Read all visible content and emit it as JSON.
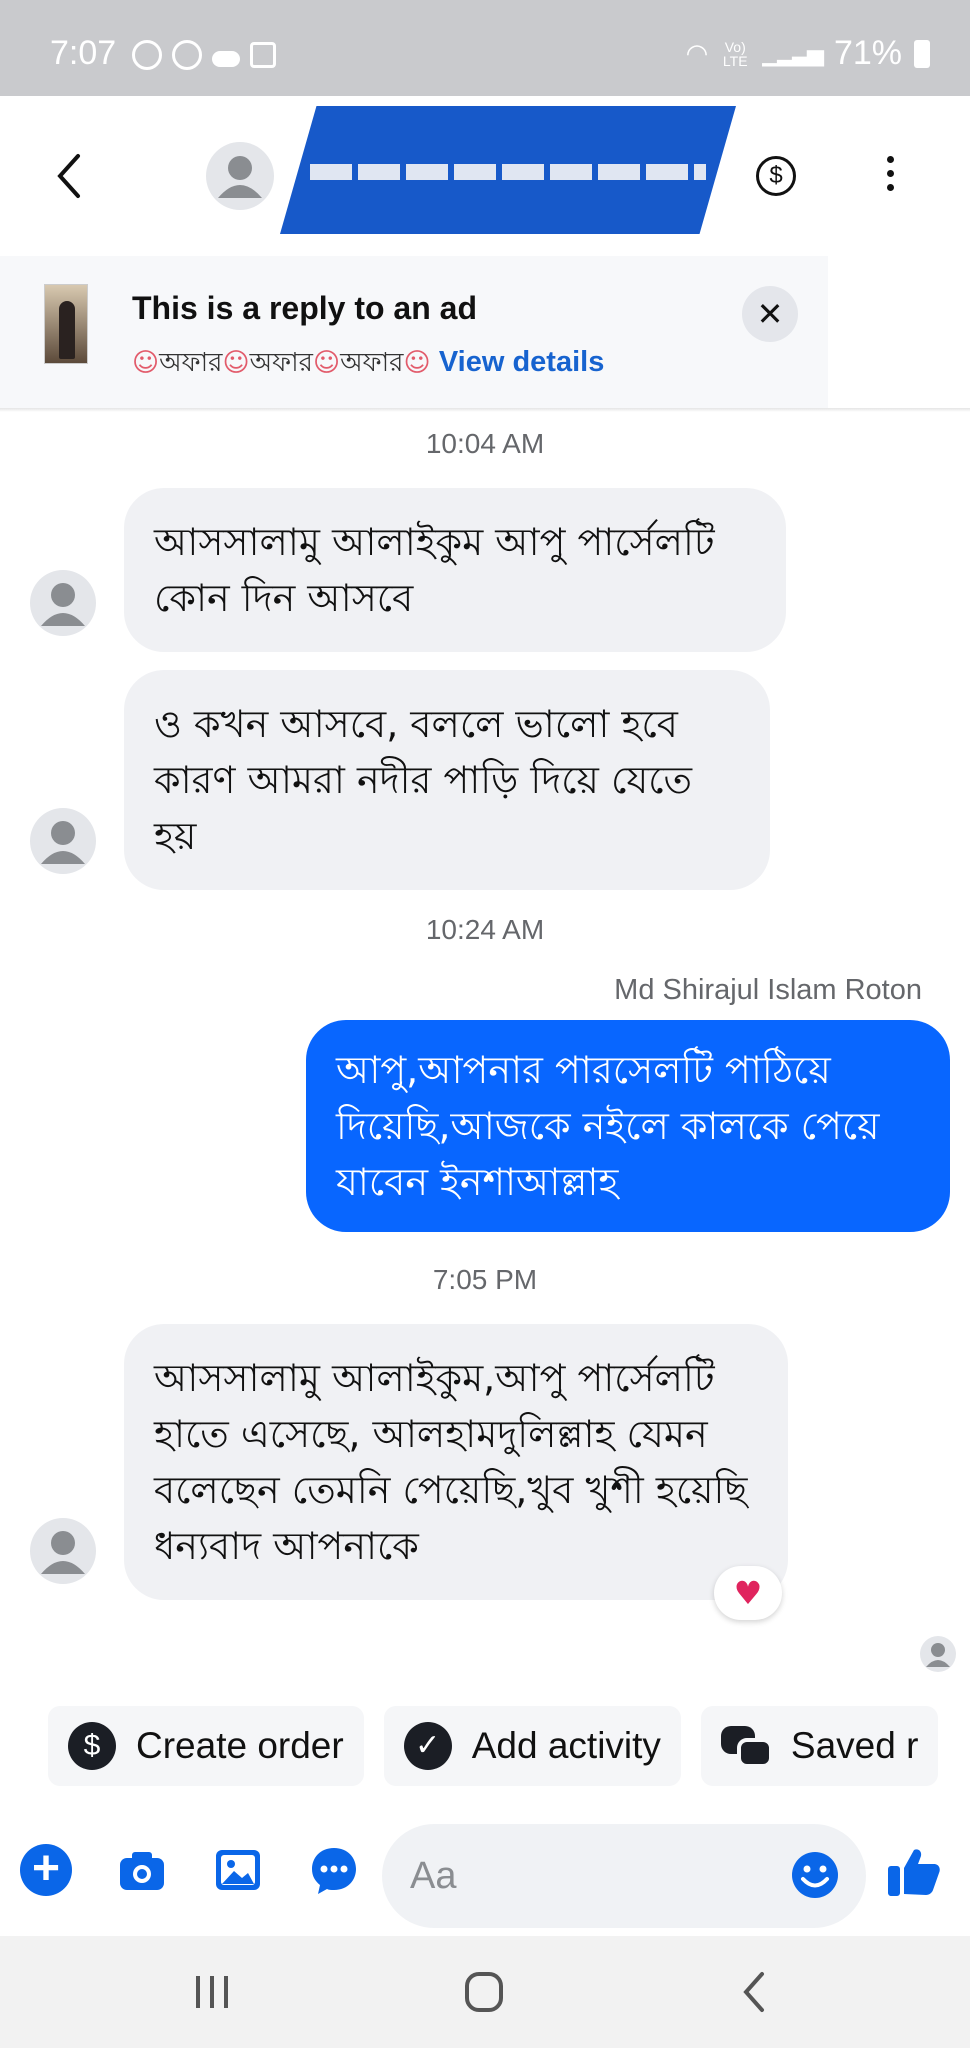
{
  "status_bar": {
    "time": "7:07",
    "battery": "71%",
    "network": "LTE"
  },
  "header": {
    "icons": [
      "back-arrow-icon",
      "avatar",
      "dollar-icon",
      "more-vertical-icon"
    ]
  },
  "ad_banner": {
    "title": "This is a reply to an ad",
    "offer_text": "অফার",
    "link": "View details"
  },
  "messages": [
    {
      "timestamp": "10:04 AM"
    },
    {
      "direction": "in",
      "text": "আসসালামু আলাইকুম আপু পার্সেলটি কোন দিন আসবে"
    },
    {
      "direction": "in",
      "text": "ও কখন আসবে, বললে ভালো হবে কারণ  আমরা নদীর পাড়ি দিয়ে যেতে হয়"
    },
    {
      "timestamp": "10:24 AM"
    },
    {
      "sender": "Md Shirajul Islam Roton"
    },
    {
      "direction": "out",
      "text": "আপু,আপনার পারসেলটি পাঠিয়ে দিয়েছি,আজকে নইলে কালকে পেয়ে যাবেন ইনশাআল্লাহ"
    },
    {
      "timestamp": "7:05 PM"
    },
    {
      "direction": "in",
      "text": "আসসালামু আলাইকুম,আপু পার্সেলটি হাতে এসেছে, আলহামদুলিল্লাহ যেমন বলেছেন তেমনি পেয়েছি,খুব খুশী হয়েছি ধন্যবাদ আপনাকে",
      "reaction": "heart"
    }
  ],
  "quick_actions": [
    {
      "label": "Create order",
      "icon": "dollar-icon"
    },
    {
      "label": "Add activity",
      "icon": "check-icon"
    },
    {
      "label": "Saved r",
      "icon": "chat-bubbles-icon"
    }
  ],
  "composer": {
    "placeholder": "Aa",
    "icons": [
      "plus-icon",
      "camera-icon",
      "gallery-icon",
      "chat-more-icon",
      "emoji-icon",
      "like-icon"
    ],
    "accent": "#0a66e8"
  },
  "colors": {
    "outgoing_bubble": "#0866ff",
    "incoming_bubble": "#f0f1f4",
    "link": "#1763cf",
    "status_bar": "#c9cacd"
  }
}
